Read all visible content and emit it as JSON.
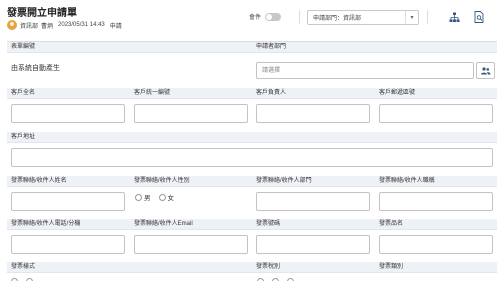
{
  "header": {
    "title": "發票開立申請單",
    "user_dept": "資訊部",
    "user_name": "曹炳",
    "datetime": "2023/05/31 14:43",
    "action": "申請",
    "toggle_label": "會件",
    "dept_select_value": "申請部門：資訊部"
  },
  "form": {
    "form_no_label": "表單編號",
    "form_no_value": "由系統自動產生",
    "applicant_dept_label": "申請者部門",
    "applicant_dept_placeholder": "請選擇",
    "customer_name_label": "客戶全名",
    "customer_taxid_label": "客戶統一編號",
    "customer_owner_label": "客戶負責人",
    "customer_zip_label": "客戶郵遞區號",
    "customer_address_label": "客戶地址",
    "contact_name_label": "發票聯絡/收件人姓名",
    "contact_gender_label": "發票聯絡/收件人性別",
    "gender_male": "男",
    "gender_female": "女",
    "contact_dept_label": "發票聯絡/收件人部門",
    "contact_title_label": "發票聯絡/收件人職稱",
    "contact_phone_label": "發票聯絡/收件人電話/分機",
    "contact_email_label": "發票聯絡/收件人Email",
    "invoice_no_label": "發票號碼",
    "product_name_label": "發票品名",
    "invoice_format_label": "發票樣式",
    "tax_type_label": "發票稅別",
    "invoice_category_label": "發票類別"
  },
  "colors": {
    "label_bg": "#eef2f7",
    "border": "#c3c3c3",
    "avatar": "#e8a33d",
    "icon": "#3a5a80"
  }
}
